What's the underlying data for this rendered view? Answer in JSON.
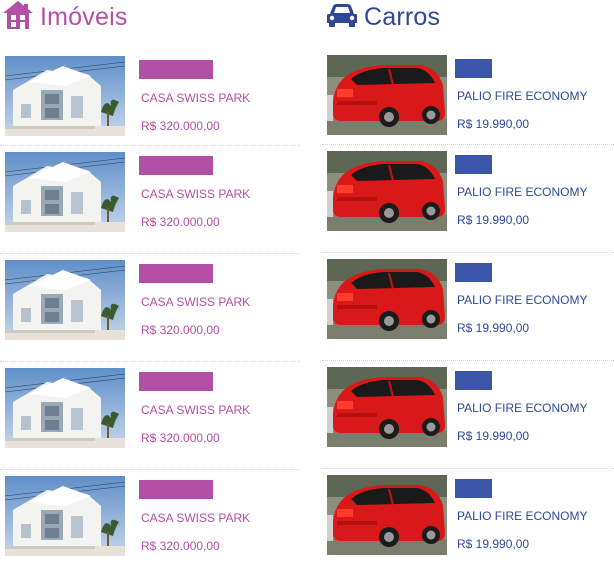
{
  "colors": {
    "imoveis_accent": "#b44fa6",
    "carros_accent": "#3b55a9"
  },
  "imoveis": {
    "icon": "house-icon",
    "title": "Imóveis",
    "items": [
      {
        "name": "CASA SWISS PARK",
        "price": "R$ 320.000,00"
      },
      {
        "name": "CASA SWISS PARK",
        "price": "R$ 320.000,00"
      },
      {
        "name": "CASA SWISS PARK",
        "price": "R$ 320.000,00"
      },
      {
        "name": "CASA SWISS PARK",
        "price": "R$ 320.000,00"
      },
      {
        "name": "CASA SWISS PARK",
        "price": "R$ 320.000,00"
      }
    ]
  },
  "carros": {
    "icon": "car-icon",
    "title": "Carros",
    "items": [
      {
        "name": "PALIO FIRE ECONOMY",
        "price": "R$ 19.990,00"
      },
      {
        "name": "PALIO FIRE ECONOMY",
        "price": "R$ 19.990,00"
      },
      {
        "name": "PALIO FIRE ECONOMY",
        "price": "R$ 19.990,00"
      },
      {
        "name": "PALIO FIRE ECONOMY",
        "price": "R$ 19.990,00"
      },
      {
        "name": "PALIO FIRE ECONOMY",
        "price": "R$ 19.990,00"
      }
    ]
  }
}
